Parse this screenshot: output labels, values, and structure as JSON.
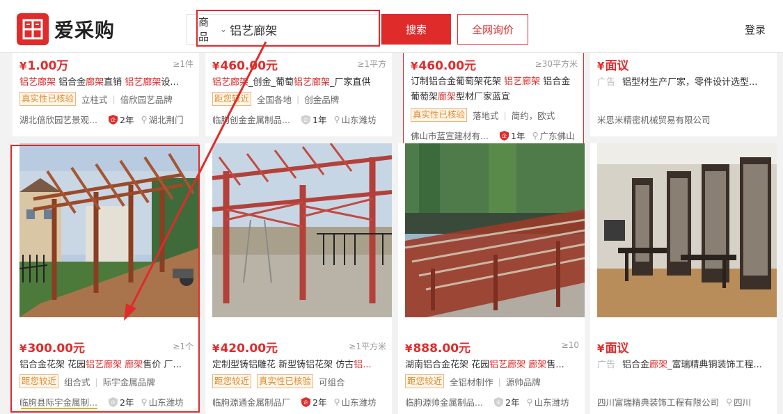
{
  "header": {
    "logo_text": "爱采购",
    "search_type": "商品",
    "search_query": "铝艺廊架",
    "search_button": "搜索",
    "inquiry_button": "全网询价",
    "login": "登录"
  },
  "row1": [
    {
      "price": "1.00万",
      "moq": "≥1件",
      "title_parts": [
        [
          "h",
          "铝艺廊架"
        ],
        [
          "n",
          " 铝合金"
        ],
        [
          "h",
          "廊架"
        ],
        [
          "n",
          "直销 "
        ],
        [
          "h",
          "铝艺廊架"
        ],
        [
          "n",
          "设..."
        ]
      ],
      "tags": [
        "真实性已核验",
        "立柱式",
        "倍欣园艺品牌"
      ],
      "company": "湖北倍欣园艺景观...",
      "years": "2年",
      "location": "湖北荆门"
    },
    {
      "price": "460.00元",
      "moq": "≥1平方",
      "title_parts": [
        [
          "h",
          "铝艺廊架"
        ],
        [
          "n",
          "_创金_葡萄"
        ],
        [
          "h",
          "铝艺廊架"
        ],
        [
          "n",
          "_厂家直供"
        ]
      ],
      "tags": [
        "距您较近",
        "全国各地",
        "创金品牌"
      ],
      "company": "临朐创金金属制品...",
      "years": "1年",
      "location": "山东潍坊"
    },
    {
      "price": "460.00元",
      "moq": "≥30平方米",
      "title_parts": [
        [
          "n",
          "订制铝合金葡萄架花架 "
        ],
        [
          "h",
          "铝艺廊架"
        ],
        [
          "n",
          " 铝合金葡萄架"
        ],
        [
          "h",
          "廊架"
        ],
        [
          "n",
          "型材厂家蓝宣"
        ]
      ],
      "tags": [
        "真实性已核验",
        "落地式",
        "简约，欧式"
      ],
      "company": "佛山市蓝宣建材有...",
      "years": "1年",
      "location": "广东佛山"
    },
    {
      "price": "面议",
      "moq": "",
      "ad": "广告",
      "title_parts": [
        [
          "n",
          "铝型材生产厂家，零件设计选型..."
        ]
      ],
      "tags": [],
      "company": "米思米精密机械贸易有限公司",
      "years": "",
      "location": ""
    }
  ],
  "row2": [
    {
      "price": "300.00元",
      "moq": "≥1个",
      "title_parts": [
        [
          "n",
          "铝合金花架 花园"
        ],
        [
          "h",
          "铝艺廊架"
        ],
        [
          "n",
          " "
        ],
        [
          "h",
          "廊架"
        ],
        [
          "n",
          "售价 厂..."
        ]
      ],
      "tags": [
        "距您较近",
        "组合式",
        "际宇金属品牌"
      ],
      "company": "临朐县际宇金属制...",
      "years": "2年",
      "location": "山东潍坊"
    },
    {
      "price": "420.00元",
      "moq": "≥1平方米",
      "title_parts": [
        [
          "n",
          "定制型铸铝雕花 新型铸铝花架 仿古"
        ],
        [
          "h",
          "铝..."
        ]
      ],
      "tags": [
        "距您较近",
        "真实性已核验",
        "可组合"
      ],
      "company": "临朐源通金属制品厂",
      "years": "2年",
      "location": "山东潍坊"
    },
    {
      "price": "888.00元",
      "moq": "≥10",
      "title_parts": [
        [
          "n",
          "湖南铝合金花架 花园"
        ],
        [
          "h",
          "铝艺廊架"
        ],
        [
          "n",
          " "
        ],
        [
          "h",
          "廊架"
        ],
        [
          "n",
          "售..."
        ]
      ],
      "tags": [
        "距您较近",
        "全铝材制作",
        "源帅品牌"
      ],
      "company": "临朐源帅金属制品...",
      "years": "2年",
      "location": "山东潍坊"
    },
    {
      "price": "面议",
      "moq": "",
      "ad": "广告",
      "title_parts": [
        [
          "n",
          "铝合金"
        ],
        [
          "h",
          "廊架"
        ],
        [
          "n",
          "_富瑞精典铜装饰工程..."
        ]
      ],
      "tags": [],
      "company": "四川富瑞精典装饰工程有限公司",
      "years": "",
      "location": "四川"
    }
  ],
  "colors": {
    "accent": "#e02b2b",
    "tag_orange": "#e08a2a",
    "annotation_yellow": "#e0b200"
  }
}
